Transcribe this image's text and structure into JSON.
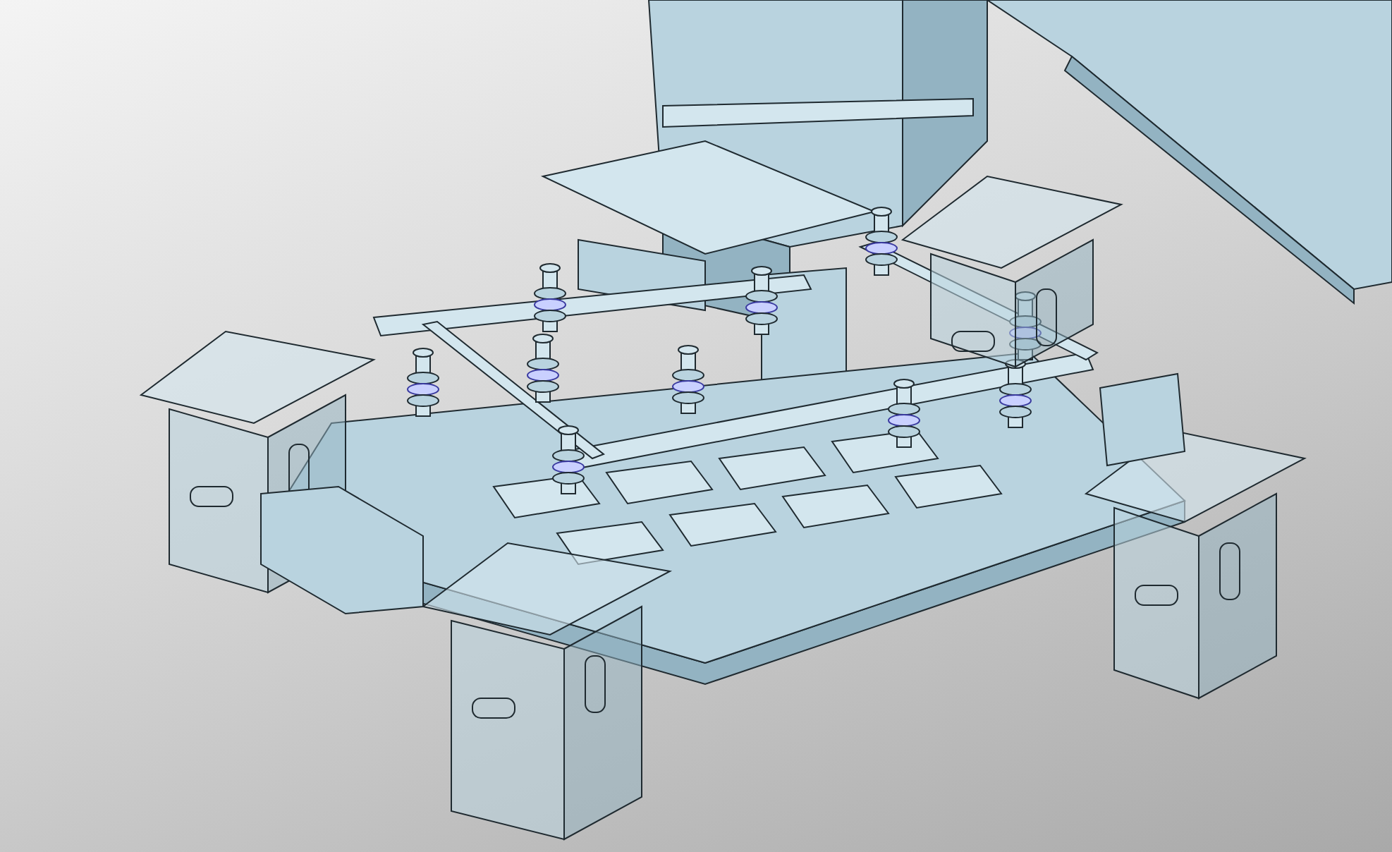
{
  "viewport": {
    "kind": "cad-model"
  }
}
